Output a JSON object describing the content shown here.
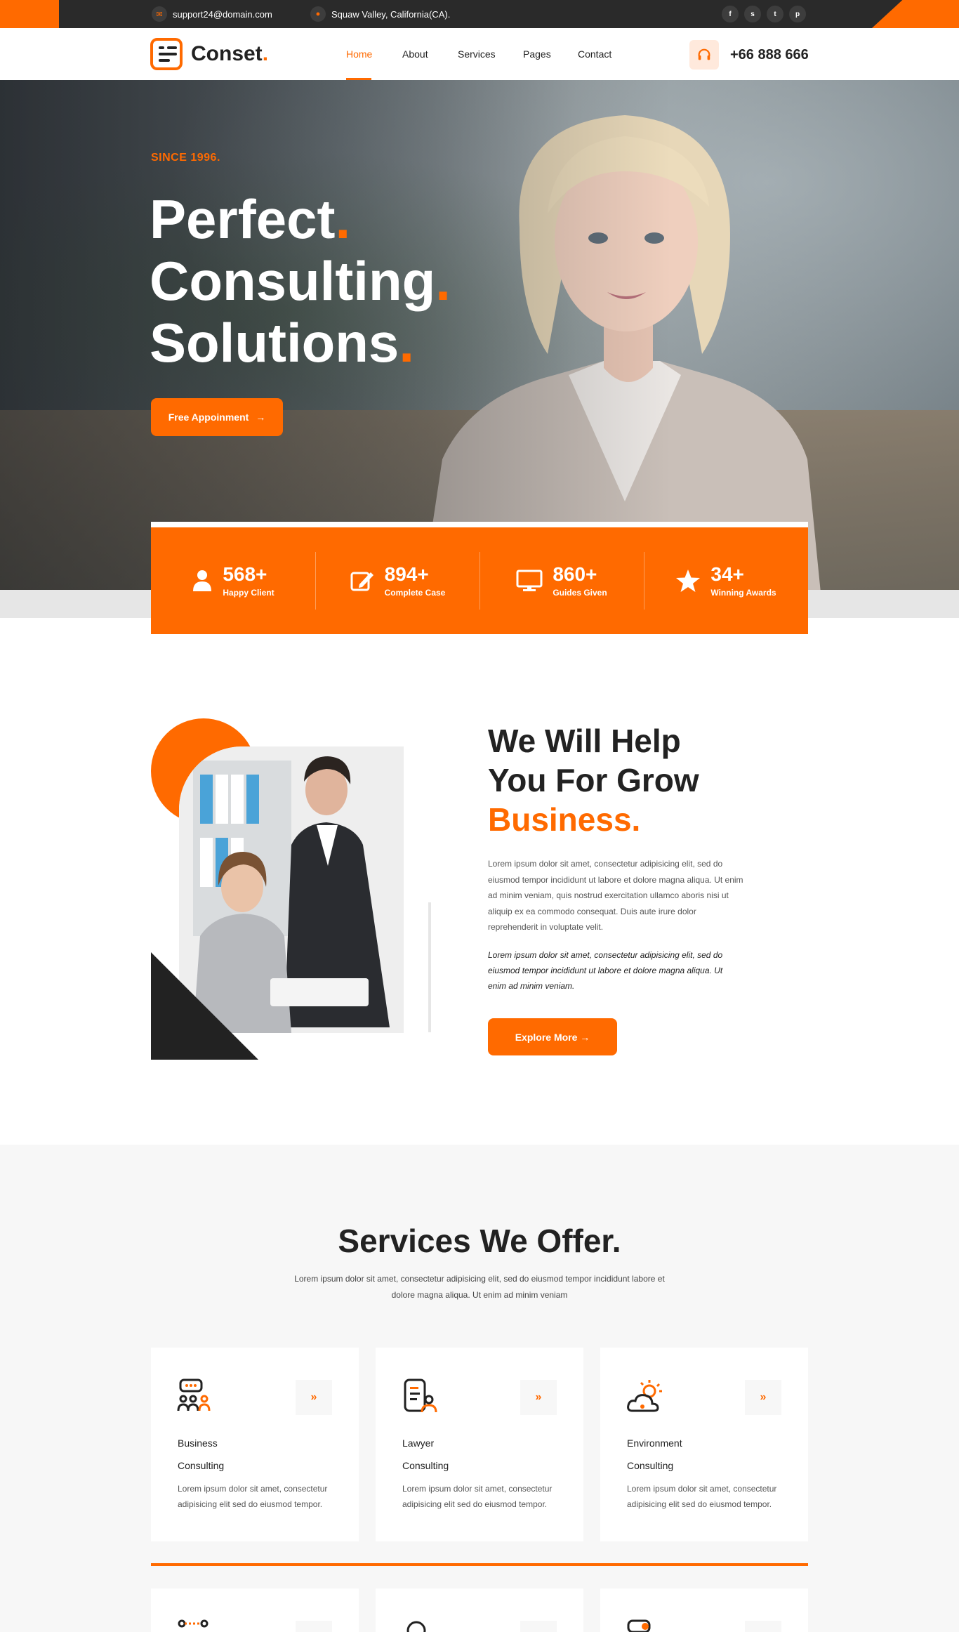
{
  "topbar": {
    "email": "support24@domain.com",
    "address": "Squaw Valley, California(CA).",
    "social": [
      "f",
      "s",
      "t",
      "p"
    ]
  },
  "header": {
    "logo": "Conset",
    "logo_dot": ".",
    "nav": [
      "Home",
      "About",
      "Services",
      "Pages",
      "Contact"
    ],
    "phone": "+66 888 666"
  },
  "hero": {
    "since": "SINCE 1996.",
    "line1": "Perfect",
    "line2": "Consulting",
    "line3": "Solutions",
    "dot": ".",
    "button": "Free Appoinment"
  },
  "stats": [
    {
      "num": "568+",
      "label": "Happy Client",
      "icon": "user-icon"
    },
    {
      "num": "894+",
      "label": "Complete Case",
      "icon": "edit-icon"
    },
    {
      "num": "860+",
      "label": "Guides Given",
      "icon": "monitor-icon"
    },
    {
      "num": "34+",
      "label": "Winning Awards",
      "icon": "star-icon"
    }
  ],
  "about": {
    "h1": "We Will Help",
    "h2": "You For Grow",
    "h3": "Business.",
    "para": "Lorem ipsum dolor sit amet, consectetur adipisicing elit, sed do eiusmod tempor incididunt ut labore et dolore magna aliqua. Ut enim ad minim veniam, quis nostrud exercitation ullamco aboris nisi ut aliquip ex ea commodo consequat. Duis aute irure dolor reprehenderit in voluptate velit.",
    "quote": "Lorem ipsum dolor sit amet, consectetur adipisicing elit, sed do eiusmod tempor incididunt ut labore et dolore magna aliqua. Ut enim ad minim veniam.",
    "button": "Explore More →"
  },
  "services": {
    "title": "Services We Offer.",
    "sub": "Lorem ipsum dolor sit amet, consectetur adipisicing elit, sed do eiusmod tempor incididunt labore et dolore magna aliqua. Ut enim ad minim veniam",
    "arrow": "»",
    "cards": [
      {
        "l1": "Business",
        "l2": "Consulting",
        "desc": "Lorem ipsum dolor sit amet, consectetur adipisicing elit sed do eiusmod tempor.",
        "icon": "team-chat-icon"
      },
      {
        "l1": "Lawyer",
        "l2": "Consulting",
        "desc": "Lorem ipsum dolor sit amet, consectetur adipisicing elit sed do eiusmod tempor.",
        "icon": "document-user-icon"
      },
      {
        "l1": "Environment",
        "l2": "Consulting",
        "desc": "Lorem ipsum dolor sit amet, consectetur adipisicing elit sed do eiusmod tempor.",
        "icon": "sun-cloud-icon"
      }
    ]
  },
  "colors": {
    "accent": "#ff6a00",
    "dark": "#222222",
    "topbar": "#2a2a2a"
  }
}
